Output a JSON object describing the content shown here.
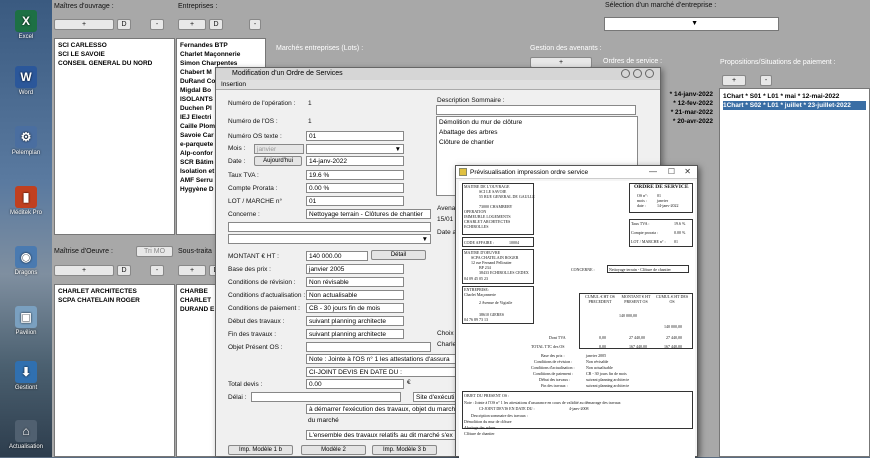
{
  "desktop_icons": [
    {
      "label": "Excel",
      "color": "#1d7044",
      "glyph": "X"
    },
    {
      "label": "Word",
      "color": "#2b579a",
      "glyph": "W"
    },
    {
      "label": "Pelemplan",
      "color": "#4a6ea0",
      "glyph": "⚙"
    },
    {
      "label": "Méditek Pro",
      "color": "#c04020",
      "glyph": "▮"
    },
    {
      "label": "Dragons",
      "color": "#4a7ab0",
      "glyph": "◉"
    },
    {
      "label": "Pavilion",
      "color": "#7aa0c0",
      "glyph": "▣"
    },
    {
      "label": "Gestiont",
      "color": "#3070b0",
      "glyph": "⬇"
    },
    {
      "label": "Actualisation",
      "color": "#506070",
      "glyph": "⌂"
    }
  ],
  "main": {
    "maitres_label": "Maîtres d'ouvrage :",
    "entreprises_label": "Entreprises :",
    "selection_label": "Sélection d'un marché d'entreprise :",
    "marches_label": "Marchés entreprises (Lots) :",
    "avenants_label": "Gestion des avenants :",
    "ordres_label": "Ordres de service :",
    "propositions_label": "Propositions/Situations de paiement :",
    "maitre_oeuvre_label": "Maîtrise d'Oeuvre :",
    "sous_traitants_label": "Sous-traita",
    "tri_mo_label": "Tri MO",
    "plus": "+",
    "minus": "-",
    "d": "D",
    "maitres": [
      "SCI CARLESSO",
      "SCI LE SAVOIE",
      "CONSEIL GENERAL DU NORD"
    ],
    "entreprises": [
      "Fernandes BTP",
      "Charlet Maçonnerie",
      "Simon Charpentes",
      "Chabert M",
      "DuRand Co",
      "Migdal Bo",
      "ISOLANTS",
      "Duchen Pl",
      "IEJ Electri",
      "Caille Plom",
      "Savoie Car",
      "e-parquete",
      "Alp-confor",
      "SCR Bâtim",
      "Isolation et",
      "AMF Serru",
      "Hygyène D"
    ],
    "maitres_oeuvre": [
      "CHARLET ARCHITECTES",
      "SCPA CHATELAIN ROGER"
    ],
    "sous_traitants": [
      "CHARBE",
      "CHARLET",
      "DURAND E"
    ],
    "ordres": [
      "* 14-janv-2022",
      "* 12-fev-2022",
      "* 21-mar-2022",
      "* 20-avr-2022"
    ],
    "propositions": [
      "1Chart * S01 * L01 * mai * 12-mai-2022",
      "1Chart * S02 * L01 * juillet * 23-juillet-2022"
    ]
  },
  "modal": {
    "title": "Modification d'un Ordre de Services",
    "tab": "Insertion",
    "fields": {
      "num_operation_label": "Numéro de l'opération :",
      "num_operation": "1",
      "num_os_label": "Numéro de l'OS :",
      "num_os": "1",
      "num_os_texte_label": "Numéro OS texte :",
      "num_os_texte": "01",
      "mois_label": "Mois :",
      "mois": "janvier",
      "date_label": "Date :",
      "aujourdhui": "Aujourd'hui",
      "date": "14-janv-2022",
      "tva_label": "Taux TVA :",
      "tva": "19.6 %",
      "prorata_label": "Compte Prorata :",
      "prorata": "0.00 %",
      "lot_label": "LOT / MARCHE n°",
      "lot": "01",
      "concerne_label": "Concerne :",
      "concerne": "Nettoyage terrain - Clôtures de chantier",
      "montant_label": "MONTANT € HT :",
      "montant": "140 000.00",
      "detail": "Détail",
      "base_prix_label": "Base des prix :",
      "base_prix": "janvier 2005",
      "revision_label": "Conditions de révision :",
      "revision": "Non révisable",
      "actualisation_label": "Conditions d'actualisation :",
      "actualisation": "Non actualisable",
      "paiement_label": "Conditions de paiement :",
      "paiement": "CB - 30 jours fin de mois",
      "debut_label": "Début des travaux :",
      "debut": "suivant planning architecte",
      "fin_label": "Fin des travaux :",
      "fin": "suivant planning architecte",
      "objet_label": "Objet Présent OS :",
      "note": "Note : Jointe à l'OS n° 1 les attestations d'assura",
      "ci_joint": "CI-JOINT DEVIS EN DATE DU :",
      "total_devis_label": "Total devis :",
      "total_devis": "0.00",
      "delai_label": "Délai :",
      "site": "Site d'exécuti",
      "demarrer": "à démarrer l'exécution des travaux, objet du marché",
      "du_marche": "du marché",
      "ensemble": "L'ensemble des travaux relatifs au dit marché s'ex",
      "choix": "Choix o",
      "charle": "Charle",
      "avenant": "Avena",
      "avenant_num": "15/01",
      "date_label2": "Date a",
      "euro": "€",
      "description_label": "Description Sommaire :",
      "description": [
        "Démolition du mur de clôture",
        "Abattage des arbres",
        "Clôture de chantier"
      ]
    },
    "buttons": [
      "Imp. Modèle 1 b",
      "Modèle 2",
      "Imp. Modèle 3 b"
    ]
  },
  "preview": {
    "title": "Prévisualisation impression ordre service",
    "doc": {
      "maitre_ouvrage": "MAITRE DE L'OUVRAGE",
      "mo_name": "SCI LE SAVOIE",
      "mo_addr": "55 RUE GENERAL DE GAULLE",
      "mo_city": "73000 CHAMBERY",
      "operation": "OPERATION",
      "op1": "IMMEUBLE LOGEMENTS",
      "op2": "CHARLET ARCHITECTES",
      "op3": "ECHIROLLES",
      "code_affaire": "CODE AFFAIRE :",
      "code_val": "10004",
      "moe": "MAITRE D'OEUVRE",
      "moe_name": "SCPA CHATELAIN ROGER",
      "moe_addr": "12 rue Fernand Pelloutier",
      "moe_bp": "BP 234",
      "moe_city": "38433 ECHIROLLES CEDEX",
      "moe_tel": "04 09 45 05 23",
      "entreprise": "ENTREPRISE:",
      "ent_name": "Charlet Maçonnerie",
      "ent_addr": "2 Avenue de Vigizile",
      "ent_city": "38610 GIERES",
      "ent_tel": "04 76 89 73 13",
      "os_title": "ORDRE DE SERVICE",
      "os_n": "OS n°:",
      "os_n_val": "01",
      "mois": "mois :",
      "mois_val": "janvier",
      "date": "date :",
      "date_val": "14-janv-2022",
      "tva": "Taux TVA :",
      "tva_val": "19.6 %",
      "prorata": "Compte prorata :",
      "prorata_val": "0.00 %",
      "lot": "LOT / MARCHE n° :",
      "lot_val": "01",
      "concerne": "CONCERNE :",
      "concerne_val": "Nettoyage terrain - Clôture de chantier",
      "col1": "CUMUL € HT OS PRECEDENT",
      "col2": "MONTANT € HT PRESENT OS",
      "col3": "CUMUL € HT DES OS",
      "v1": "140 000,00",
      "v2": "140 000,00",
      "z1": "0,00",
      "t1": "27 440,00",
      "t2": "27 440,00",
      "z2": "0,00",
      "t3": "167 440,00",
      "t4": "167 440,00",
      "dont_tva": "Dont TVA",
      "total_ttc": "TOTAL TTC des OS",
      "base_prix": "Base des prix :",
      "base_prix_val": "janvier 2005",
      "revision": "Conditions de révision :",
      "revision_val": "Non révisable",
      "actu": "Conditions d'actualisation :",
      "actu_val": "Non actualisable",
      "paie": "Conditions de paiement :",
      "paie_val": "CB - 30 jours fin de mois",
      "debut": "Début des travaux :",
      "debut_val": "suivant planning architecte",
      "fin": "Fin des travaux :",
      "fin_val": "suivant planning architecte",
      "objet": "OBJET DU PRESENT OS :",
      "note": "Note : Jointe à l'OS n° 1 les attestations d'assurance en cours de validité au démarrage des travaux",
      "ci_joint": "CI-JOINT DEVIS EN DATE DU :",
      "ci_date": "4-janv-2008",
      "desc": "Description sommaire des travaux :",
      "d1": "Démolition du mur de clôture",
      "d2": "Abattage des arbres",
      "d3": "Clôture de chantier"
    }
  }
}
